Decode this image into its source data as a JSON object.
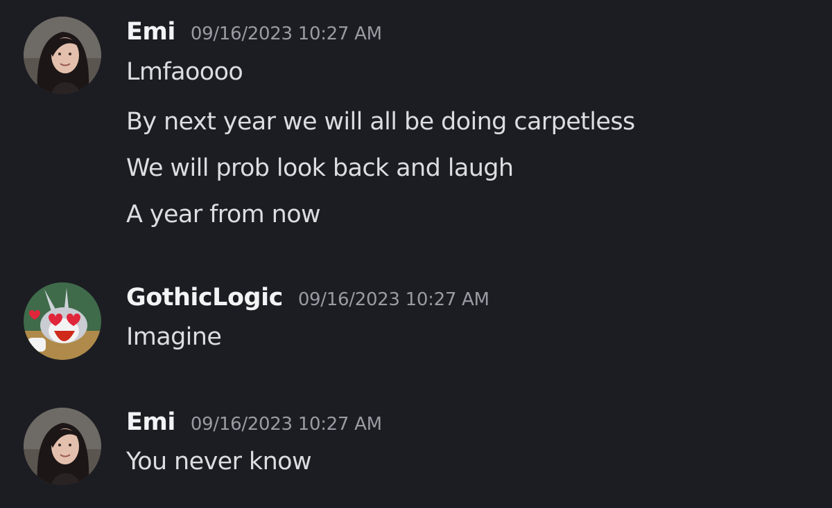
{
  "messages": [
    {
      "username": "Emi",
      "timestamp": "09/16/2023 10:27 AM",
      "avatar_icon": "woman-portrait-avatar",
      "lines": [
        "Lmfaoooo",
        "By next year we will all be doing carpetless",
        "We will prob look back and laugh",
        "A year from now"
      ]
    },
    {
      "username": "GothicLogic",
      "timestamp": "09/16/2023 10:27 AM",
      "avatar_icon": "bugs-bunny-heart-eyes-avatar",
      "lines": [
        "Imagine"
      ]
    },
    {
      "username": "Emi",
      "timestamp": "09/16/2023 10:27 AM",
      "avatar_icon": "woman-portrait-avatar",
      "lines": [
        "You never know"
      ]
    }
  ],
  "colors": {
    "background": "#1c1d22",
    "username": "#f2f3f5",
    "timestamp": "#9a9ba3",
    "message_text": "#dcdde1"
  }
}
